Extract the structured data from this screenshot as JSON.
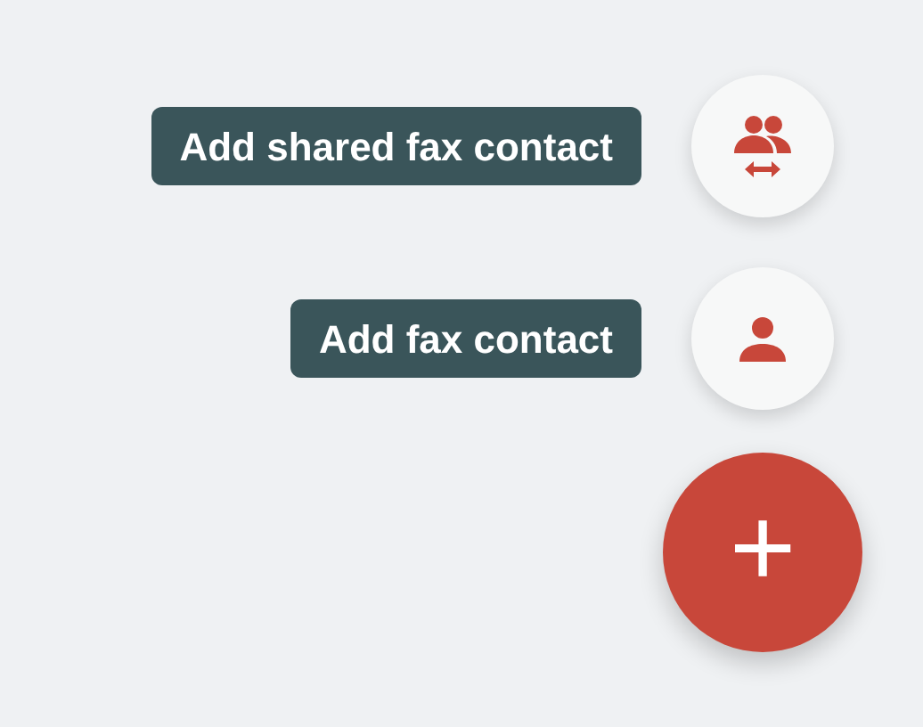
{
  "actions": [
    {
      "label": "Add shared fax contact",
      "kind": "shared"
    },
    {
      "label": "Add fax contact",
      "kind": "single"
    }
  ],
  "fab": {
    "symbol": "+"
  }
}
